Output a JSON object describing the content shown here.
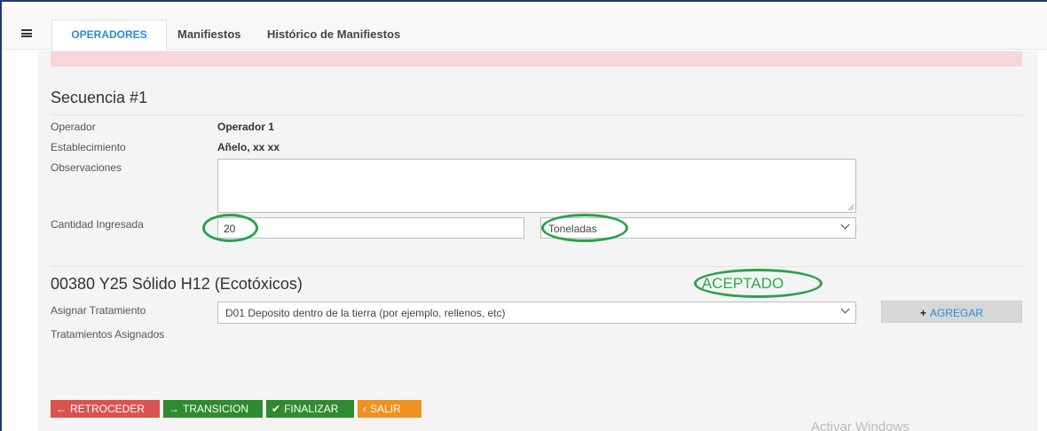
{
  "nav": {
    "tabs": [
      {
        "label": "OPERADORES",
        "active": true
      },
      {
        "label": "Manifiestos",
        "active": false
      },
      {
        "label": "Histórico de Manifiestos",
        "active": false
      }
    ]
  },
  "sequence": {
    "title": "Secuencia #1",
    "operator_label": "Operador",
    "operator_value": "Operador 1",
    "establishment_label": "Establecimiento",
    "establishment_value": "Añelo, xx xx",
    "observations_label": "Observaciones",
    "observations_value": "",
    "quantity_label": "Cantidad Ingresada",
    "quantity_value": "20",
    "unit_value": "Toneladas"
  },
  "residue": {
    "title": "00380 Y25 Sólido H12 (Ecotóxicos)",
    "status": "ACEPTADO",
    "assign_label": "Asignar Tratamiento",
    "treatment_value": "D01 Deposito dentro de la tierra (por ejemplo, rellenos, etc)",
    "add_button": "AGREGAR",
    "assigned_label": "Tratamientos Asignados"
  },
  "actions": {
    "back": "RETROCEDER",
    "transition": "TRANSICION",
    "finish": "FINALIZAR",
    "exit": "SALIR"
  },
  "watermark": "Activar Windows",
  "colors": {
    "accent": "#2a8bd8",
    "highlight_circle": "#2ca24a",
    "danger": "#d9534f",
    "success": "#2e8b2e",
    "warning": "#f0921e",
    "alert_bg": "#f6d6d6"
  }
}
